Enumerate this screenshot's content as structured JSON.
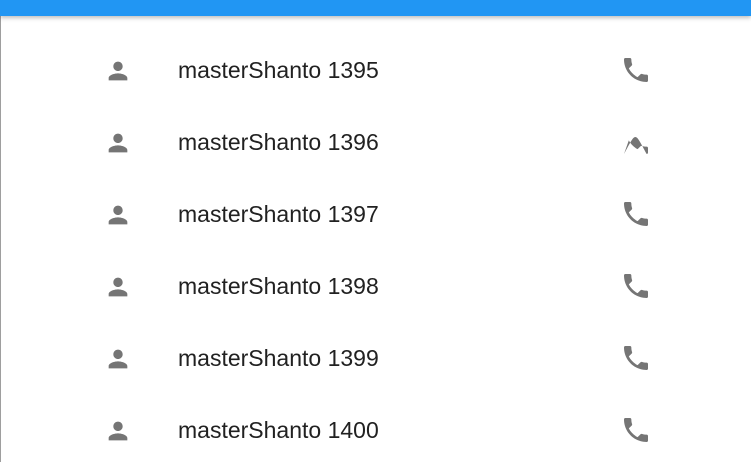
{
  "app_bar": {
    "color": "#2196f3"
  },
  "icon_color": "#757575",
  "contacts": [
    {
      "name": "masterShanto 1395",
      "leading_icon": "person-icon",
      "trailing_icon": "phone-icon"
    },
    {
      "name": "masterShanto 1396",
      "leading_icon": "person-icon",
      "trailing_icon": "phone-icon"
    },
    {
      "name": "masterShanto 1397",
      "leading_icon": "person-icon",
      "trailing_icon": "phone-icon"
    },
    {
      "name": "masterShanto 1398",
      "leading_icon": "person-icon",
      "trailing_icon": "phone-icon"
    },
    {
      "name": "masterShanto 1399",
      "leading_icon": "person-icon",
      "trailing_icon": "phone-icon"
    },
    {
      "name": "masterShanto 1400",
      "leading_icon": "person-icon",
      "trailing_icon": "phone-icon"
    }
  ]
}
